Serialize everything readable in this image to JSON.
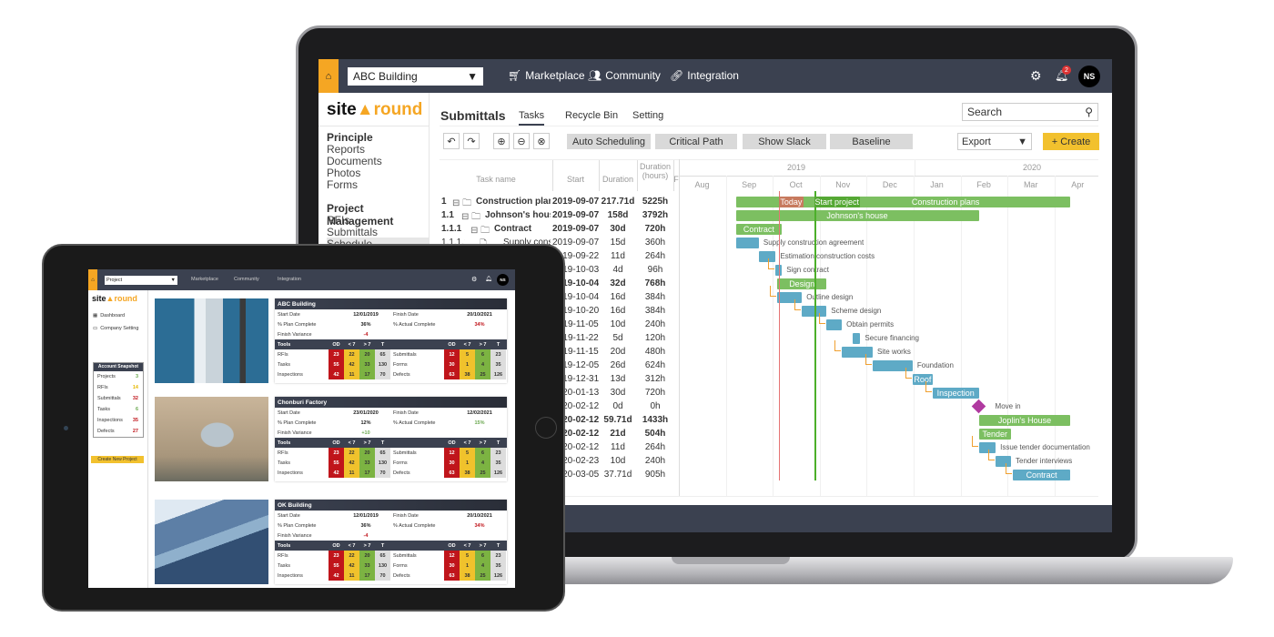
{
  "colors": {
    "accent": "#f5a623",
    "topbar": "#3b4150",
    "project_bar": "#7cbf61",
    "task_bar": "#5eaac6",
    "milestone": "#b03aa0",
    "today_line": "#e57373",
    "start_line": "#4caf2a",
    "link": "#f0a030"
  },
  "laptop": {
    "topbar": {
      "project_select": "ABC Building",
      "nav": [
        {
          "label": "Marketplace",
          "icon": "cart-icon"
        },
        {
          "label": "Community",
          "icon": "users-icon"
        },
        {
          "label": "Integration",
          "icon": "link-icon"
        }
      ],
      "notifications": "2",
      "avatar": "NS"
    },
    "logo": {
      "a": "site",
      "b": "round"
    },
    "sidebar": {
      "groups": [
        {
          "title": "Principle",
          "items": [
            "Reports",
            "Documents",
            "Photos",
            "Forms"
          ]
        },
        {
          "title": "Project Management",
          "items": [
            "RFIs",
            "Submittals",
            "Schedule"
          ]
        }
      ]
    },
    "header": {
      "title": "Submittals",
      "tabs": [
        "Tasks",
        "Recycle Bin",
        "Setting"
      ],
      "active_tab": "Tasks",
      "search_placeholder": "Search"
    },
    "toolbar": {
      "buttons": [
        "Auto Scheduling",
        "Critical Path",
        "Show Slack",
        "Baseline"
      ],
      "export": "Export",
      "create": "+ Create"
    },
    "grid": {
      "columns": [
        "Task name",
        "Start",
        "Duration",
        "Duration (hours)",
        "F"
      ],
      "rows": [
        {
          "wbs": "1",
          "name": "Construction plans",
          "start": "2019-09-07",
          "dur": "217.71d",
          "hours": "5225h",
          "type": "project",
          "level": 0,
          "days": 217.71,
          "label_in": true
        },
        {
          "wbs": "1.1",
          "name": "Johnson's house",
          "start": "2019-09-07",
          "dur": "158d",
          "hours": "3792h",
          "type": "project",
          "level": 1,
          "days": 158,
          "label_in": true
        },
        {
          "wbs": "1.1.1",
          "name": "Contract",
          "start": "2019-09-07",
          "dur": "30d",
          "hours": "720h",
          "type": "project",
          "level": 2,
          "days": 30,
          "label_in": true
        },
        {
          "wbs": "1.1.1.1",
          "name": "Supply construction agreement",
          "start": "2019-09-07",
          "dur": "15d",
          "hours": "360h",
          "type": "task",
          "level": 3,
          "days": 15
        },
        {
          "wbs": "",
          "name": "Estimation construction costs",
          "start": "2019-09-22",
          "dur": "11d",
          "hours": "264h",
          "type": "task",
          "level": 3,
          "days": 11
        },
        {
          "wbs": "",
          "name": "Sign contract",
          "start": "2019-10-03",
          "dur": "4d",
          "hours": "96h",
          "type": "task",
          "level": 3,
          "days": 4
        },
        {
          "wbs": "",
          "name": "Design",
          "start": "2019-10-04",
          "dur": "32d",
          "hours": "768h",
          "type": "project",
          "level": 2,
          "days": 32,
          "label_in": true
        },
        {
          "wbs": "",
          "name": "Outline design",
          "start": "2019-10-04",
          "dur": "16d",
          "hours": "384h",
          "type": "task",
          "level": 3,
          "days": 16
        },
        {
          "wbs": "",
          "name": "Scheme design",
          "start": "2019-10-20",
          "dur": "16d",
          "hours": "384h",
          "type": "task",
          "level": 3,
          "days": 16
        },
        {
          "wbs": "",
          "name": "Obtain permits",
          "start": "2019-11-05",
          "dur": "10d",
          "hours": "240h",
          "type": "task",
          "level": 3,
          "days": 10
        },
        {
          "wbs": "",
          "name": "Secure financing",
          "start": "2019-11-22",
          "dur": "5d",
          "hours": "120h",
          "type": "task",
          "level": 3,
          "days": 5
        },
        {
          "wbs": "",
          "name": "Site works",
          "start": "2019-11-15",
          "dur": "20d",
          "hours": "480h",
          "type": "task",
          "level": 3,
          "days": 20
        },
        {
          "wbs": "",
          "name": "Foundation",
          "start": "2019-12-05",
          "dur": "26d",
          "hours": "624h",
          "type": "task",
          "level": 3,
          "days": 26
        },
        {
          "wbs": "",
          "name": "Roof",
          "start": "2019-12-31",
          "dur": "13d",
          "hours": "312h",
          "type": "task",
          "level": 3,
          "days": 13,
          "label_in": true
        },
        {
          "wbs": "",
          "name": "Inspection",
          "start": "2020-01-13",
          "dur": "30d",
          "hours": "720h",
          "type": "task",
          "level": 3,
          "days": 30,
          "label_in": true
        },
        {
          "wbs": "",
          "name": "Move in",
          "start": "2020-02-12",
          "dur": "0d",
          "hours": "0h",
          "type": "milestone",
          "level": 3,
          "days": 0
        },
        {
          "wbs": "",
          "name": "Joplin's House",
          "start": "2020-02-12",
          "dur": "59.71d",
          "hours": "1433h",
          "type": "project",
          "level": 1,
          "days": 59.71,
          "label_in": true
        },
        {
          "wbs": "",
          "name": "Tender",
          "start": "2020-02-12",
          "dur": "21d",
          "hours": "504h",
          "type": "project",
          "level": 2,
          "days": 21,
          "label_in": true
        },
        {
          "wbs": "",
          "name": "Issue tender documentation",
          "start": "2020-02-12",
          "dur": "11d",
          "hours": "264h",
          "type": "task",
          "level": 3,
          "days": 11
        },
        {
          "wbs": "",
          "name": "Tender interviews",
          "start": "2020-02-23",
          "dur": "10d",
          "hours": "240h",
          "type": "task",
          "level": 3,
          "days": 10
        },
        {
          "wbs": "",
          "name": "Contract",
          "start": "2020-03-05",
          "dur": "37.71d",
          "hours": "905h",
          "type": "task",
          "level": 3,
          "days": 37.71,
          "label_in": true
        }
      ]
    },
    "gantt": {
      "years": [
        "2019",
        "2020"
      ],
      "months": [
        "Aug",
        "Sep",
        "Oct",
        "Nov",
        "Dec",
        "Jan",
        "Feb",
        "Mar",
        "Apr"
      ],
      "markers": [
        {
          "label": "Today"
        },
        {
          "label": "Start project"
        }
      ]
    }
  },
  "tablet": {
    "topbar": {
      "project_select": "Project",
      "nav": [
        "Marketplace",
        "Community",
        "Integration"
      ],
      "avatar": "NS"
    },
    "logo": {
      "a": "site",
      "b": "round"
    },
    "sidebar": {
      "items": [
        {
          "label": "Dashboard",
          "icon": "grid-icon"
        },
        {
          "label": "Company Setting",
          "icon": "laptop-icon"
        }
      ]
    },
    "snapshot": {
      "title": "Account Snapshot",
      "items": [
        {
          "label": "Projects",
          "value": "3",
          "color": "#6aa84f"
        },
        {
          "label": "RFIs",
          "value": "14",
          "color": "#e6b800"
        },
        {
          "label": "Submittals",
          "value": "32",
          "color": "#c0151b"
        },
        {
          "label": "Tasks",
          "value": "6",
          "color": "#6aa84f"
        },
        {
          "label": "Inspections",
          "value": "35",
          "color": "#c0151b"
        },
        {
          "label": "Defects",
          "value": "27",
          "color": "#c0151b"
        }
      ]
    },
    "create_button": "Create New Project",
    "labels": {
      "start": "Start Date",
      "finish": "Finish Date",
      "plan": "% Plan Complete",
      "actual": "% Actual Complete",
      "variance": "Finish Variance",
      "tools": "Tools",
      "cols": [
        "OD",
        "< 7",
        "> 7",
        "T"
      ]
    },
    "cards": [
      {
        "title": "ABC Building",
        "image": "tower",
        "start": "12/01/2019",
        "finish": "20/10/2021",
        "plan": "36%",
        "actual": "34%",
        "actual_color": "#c0151b",
        "variance": "-4",
        "variance_color": "#c0151b",
        "left": [
          {
            "name": "RFIs",
            "v": [
              "23",
              "22",
              "20",
              "65"
            ]
          },
          {
            "name": "Tasks",
            "v": [
              "55",
              "42",
              "33",
              "130"
            ]
          },
          {
            "name": "Inspections",
            "v": [
              "42",
              "11",
              "17",
              "70"
            ]
          }
        ],
        "right": [
          {
            "name": "Submittals",
            "v": [
              "12",
              "5",
              "6",
              "23"
            ]
          },
          {
            "name": "Forms",
            "v": [
              "30",
              "1",
              "4",
              "35"
            ]
          },
          {
            "name": "Defects",
            "v": [
              "63",
              "38",
              "25",
              "126"
            ]
          }
        ]
      },
      {
        "title": "Chonburi Factory",
        "image": "aerial",
        "start": "23/01/2020",
        "finish": "12/02/2021",
        "plan": "12%",
        "actual": "15%",
        "actual_color": "#6aa84f",
        "variance": "+10",
        "variance_color": "#6aa84f",
        "left": [
          {
            "name": "RFIs",
            "v": [
              "23",
              "22",
              "20",
              "65"
            ]
          },
          {
            "name": "Tasks",
            "v": [
              "55",
              "42",
              "33",
              "130"
            ]
          },
          {
            "name": "Inspections",
            "v": [
              "42",
              "11",
              "17",
              "70"
            ]
          }
        ],
        "right": [
          {
            "name": "Submittals",
            "v": [
              "12",
              "5",
              "6",
              "23"
            ]
          },
          {
            "name": "Forms",
            "v": [
              "30",
              "1",
              "4",
              "35"
            ]
          },
          {
            "name": "Defects",
            "v": [
              "63",
              "38",
              "25",
              "126"
            ]
          }
        ]
      },
      {
        "title": "OK Building",
        "image": "glass",
        "start": "12/01/2019",
        "finish": "20/10/2021",
        "plan": "36%",
        "actual": "34%",
        "actual_color": "#c0151b",
        "variance": "-4",
        "variance_color": "#c0151b",
        "left": [
          {
            "name": "RFIs",
            "v": [
              "23",
              "22",
              "20",
              "65"
            ]
          },
          {
            "name": "Tasks",
            "v": [
              "55",
              "42",
              "33",
              "130"
            ]
          },
          {
            "name": "Inspections",
            "v": [
              "42",
              "11",
              "17",
              "70"
            ]
          }
        ],
        "right": [
          {
            "name": "Submittals",
            "v": [
              "12",
              "5",
              "6",
              "23"
            ]
          },
          {
            "name": "Forms",
            "v": [
              "30",
              "1",
              "4",
              "35"
            ]
          },
          {
            "name": "Defects",
            "v": [
              "63",
              "38",
              "25",
              "126"
            ]
          }
        ]
      }
    ]
  }
}
